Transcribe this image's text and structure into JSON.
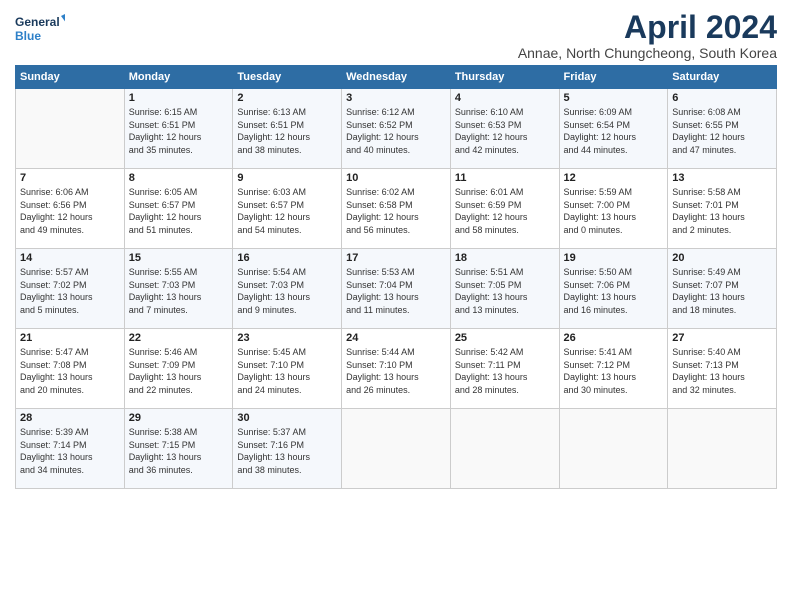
{
  "header": {
    "logo_line1": "General",
    "logo_line2": "Blue",
    "month_title": "April 2024",
    "subtitle": "Annae, North Chungcheong, South Korea"
  },
  "weekdays": [
    "Sunday",
    "Monday",
    "Tuesday",
    "Wednesday",
    "Thursday",
    "Friday",
    "Saturday"
  ],
  "weeks": [
    [
      {
        "day": "",
        "info": ""
      },
      {
        "day": "1",
        "info": "Sunrise: 6:15 AM\nSunset: 6:51 PM\nDaylight: 12 hours\nand 35 minutes."
      },
      {
        "day": "2",
        "info": "Sunrise: 6:13 AM\nSunset: 6:51 PM\nDaylight: 12 hours\nand 38 minutes."
      },
      {
        "day": "3",
        "info": "Sunrise: 6:12 AM\nSunset: 6:52 PM\nDaylight: 12 hours\nand 40 minutes."
      },
      {
        "day": "4",
        "info": "Sunrise: 6:10 AM\nSunset: 6:53 PM\nDaylight: 12 hours\nand 42 minutes."
      },
      {
        "day": "5",
        "info": "Sunrise: 6:09 AM\nSunset: 6:54 PM\nDaylight: 12 hours\nand 44 minutes."
      },
      {
        "day": "6",
        "info": "Sunrise: 6:08 AM\nSunset: 6:55 PM\nDaylight: 12 hours\nand 47 minutes."
      }
    ],
    [
      {
        "day": "7",
        "info": "Sunrise: 6:06 AM\nSunset: 6:56 PM\nDaylight: 12 hours\nand 49 minutes."
      },
      {
        "day": "8",
        "info": "Sunrise: 6:05 AM\nSunset: 6:57 PM\nDaylight: 12 hours\nand 51 minutes."
      },
      {
        "day": "9",
        "info": "Sunrise: 6:03 AM\nSunset: 6:57 PM\nDaylight: 12 hours\nand 54 minutes."
      },
      {
        "day": "10",
        "info": "Sunrise: 6:02 AM\nSunset: 6:58 PM\nDaylight: 12 hours\nand 56 minutes."
      },
      {
        "day": "11",
        "info": "Sunrise: 6:01 AM\nSunset: 6:59 PM\nDaylight: 12 hours\nand 58 minutes."
      },
      {
        "day": "12",
        "info": "Sunrise: 5:59 AM\nSunset: 7:00 PM\nDaylight: 13 hours\nand 0 minutes."
      },
      {
        "day": "13",
        "info": "Sunrise: 5:58 AM\nSunset: 7:01 PM\nDaylight: 13 hours\nand 2 minutes."
      }
    ],
    [
      {
        "day": "14",
        "info": "Sunrise: 5:57 AM\nSunset: 7:02 PM\nDaylight: 13 hours\nand 5 minutes."
      },
      {
        "day": "15",
        "info": "Sunrise: 5:55 AM\nSunset: 7:03 PM\nDaylight: 13 hours\nand 7 minutes."
      },
      {
        "day": "16",
        "info": "Sunrise: 5:54 AM\nSunset: 7:03 PM\nDaylight: 13 hours\nand 9 minutes."
      },
      {
        "day": "17",
        "info": "Sunrise: 5:53 AM\nSunset: 7:04 PM\nDaylight: 13 hours\nand 11 minutes."
      },
      {
        "day": "18",
        "info": "Sunrise: 5:51 AM\nSunset: 7:05 PM\nDaylight: 13 hours\nand 13 minutes."
      },
      {
        "day": "19",
        "info": "Sunrise: 5:50 AM\nSunset: 7:06 PM\nDaylight: 13 hours\nand 16 minutes."
      },
      {
        "day": "20",
        "info": "Sunrise: 5:49 AM\nSunset: 7:07 PM\nDaylight: 13 hours\nand 18 minutes."
      }
    ],
    [
      {
        "day": "21",
        "info": "Sunrise: 5:47 AM\nSunset: 7:08 PM\nDaylight: 13 hours\nand 20 minutes."
      },
      {
        "day": "22",
        "info": "Sunrise: 5:46 AM\nSunset: 7:09 PM\nDaylight: 13 hours\nand 22 minutes."
      },
      {
        "day": "23",
        "info": "Sunrise: 5:45 AM\nSunset: 7:10 PM\nDaylight: 13 hours\nand 24 minutes."
      },
      {
        "day": "24",
        "info": "Sunrise: 5:44 AM\nSunset: 7:10 PM\nDaylight: 13 hours\nand 26 minutes."
      },
      {
        "day": "25",
        "info": "Sunrise: 5:42 AM\nSunset: 7:11 PM\nDaylight: 13 hours\nand 28 minutes."
      },
      {
        "day": "26",
        "info": "Sunrise: 5:41 AM\nSunset: 7:12 PM\nDaylight: 13 hours\nand 30 minutes."
      },
      {
        "day": "27",
        "info": "Sunrise: 5:40 AM\nSunset: 7:13 PM\nDaylight: 13 hours\nand 32 minutes."
      }
    ],
    [
      {
        "day": "28",
        "info": "Sunrise: 5:39 AM\nSunset: 7:14 PM\nDaylight: 13 hours\nand 34 minutes."
      },
      {
        "day": "29",
        "info": "Sunrise: 5:38 AM\nSunset: 7:15 PM\nDaylight: 13 hours\nand 36 minutes."
      },
      {
        "day": "30",
        "info": "Sunrise: 5:37 AM\nSunset: 7:16 PM\nDaylight: 13 hours\nand 38 minutes."
      },
      {
        "day": "",
        "info": ""
      },
      {
        "day": "",
        "info": ""
      },
      {
        "day": "",
        "info": ""
      },
      {
        "day": "",
        "info": ""
      }
    ]
  ]
}
